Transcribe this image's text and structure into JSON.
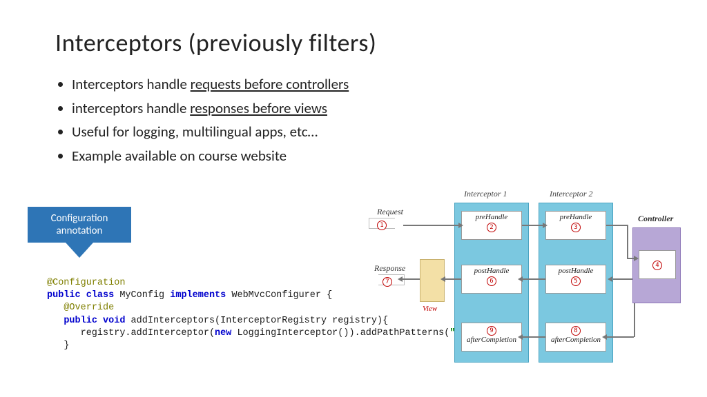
{
  "title": "Interceptors (previously filters)",
  "bullets": [
    {
      "plain": "Interceptors handle ",
      "under": "requests before controllers"
    },
    {
      "plain": "interceptors handle ",
      "under": "responses before views"
    },
    {
      "plain": "Useful for logging, multilingual apps, etc…",
      "under": ""
    },
    {
      "plain": "Example available on course website",
      "under": ""
    }
  ],
  "callout": {
    "line1": "Configuration",
    "line2": "annotation"
  },
  "code": {
    "ann1": "@Configuration",
    "kw_public": "public",
    "kw_class": "class",
    "cls": " MyConfig ",
    "kw_impl": "implements",
    "iface": " WebMvcConfigurer {",
    "ann2": "@Override",
    "kw_pv": "public void",
    "m_sig": " addInterceptors(InterceptorRegistry registry){",
    "body1": "registry.addInterceptor(",
    "kw_new": "new",
    "body2": " LoggingInterceptor()).addPathPatterns(",
    "str": "\"/*\"",
    "body3": ");",
    "close": "}"
  },
  "diagram": {
    "int1": "Interceptor 1",
    "int2": "Interceptor 2",
    "controller": "Controller",
    "request": "Request",
    "response": "Response",
    "view": "View",
    "preHandle": "preHandle",
    "postHandle": "postHandle",
    "afterCompletion": "afterCompletion",
    "steps": [
      "1",
      "2",
      "3",
      "4",
      "5",
      "6",
      "7",
      "8",
      "9"
    ]
  }
}
